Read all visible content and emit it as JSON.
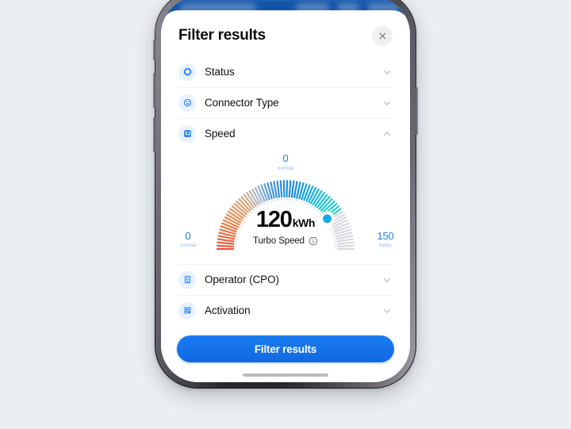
{
  "sheet": {
    "title": "Filter results",
    "close_icon": "close-icon"
  },
  "background_app": {
    "bar_color": "#1457ad"
  },
  "filters": [
    {
      "id": "status",
      "label": "Status",
      "icon": "status-ring-icon",
      "expanded": false,
      "chevron": "chevron-down-icon"
    },
    {
      "id": "connector_type",
      "label": "Connector Type",
      "icon": "connector-icon",
      "expanded": false,
      "chevron": "chevron-down-icon"
    },
    {
      "id": "speed",
      "label": "Speed",
      "icon": "speed-gauge-icon",
      "expanded": true,
      "chevron": "chevron-up-icon"
    },
    {
      "id": "operator",
      "label": "Operator (CPO)",
      "icon": "building-icon",
      "expanded": false,
      "chevron": "chevron-down-icon"
    },
    {
      "id": "activation",
      "label": "Activation",
      "icon": "grid-icon",
      "expanded": false,
      "chevron": "chevron-down-icon"
    }
  ],
  "speed_gauge": {
    "value": "120",
    "unit": "kWh",
    "caption": "Turbo Speed",
    "info_icon": "info-icon",
    "min_label": "0",
    "min_sublabel": "normal",
    "max_label": "150",
    "max_sublabel": "turbo",
    "top_label": "0",
    "top_sublabel": "normal",
    "min_value": 0,
    "max_value": 150,
    "current_value": 120,
    "tick_count": 66,
    "accent_color": "#16a6e8",
    "inactive_color": "#c9cdd2"
  },
  "cta": {
    "label": "Filter results",
    "color": "#1269e2"
  },
  "system": {
    "home_indicator": "home-indicator"
  }
}
